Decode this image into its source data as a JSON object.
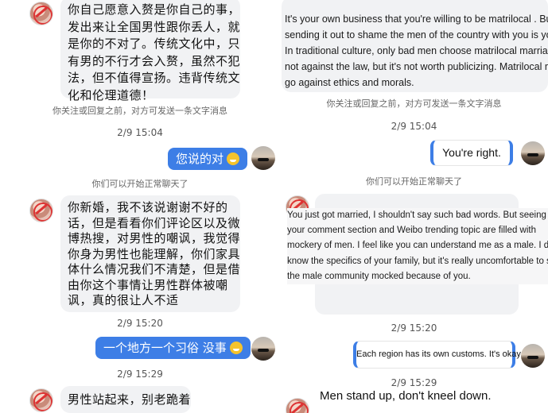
{
  "left": {
    "msg1": "你自己愿意入赘是你自己的事，\n发出来让全国男性跟你丢人，就\n是你的不对了。传统文化中，只\n有男的不行才会入赘，虽然不犯\n法，但不值得宣扬。违背传统文\n化和伦理道德！",
    "sys1": "你关注或回复之前，对方可发送一条文字消息",
    "ts1": "2/9 15:04",
    "sent1": "您说的对",
    "sys2": "你们可以开始正常聊天了",
    "msg2": "你新婚，我不该说谢谢不好的\n话，但是看看你们评论区以及微\n博热搜，对男性的嘲讽，我觉得\n你身为男性也能理解，你们家具\n体什么情况我们不清楚，但是借\n由你这个事情让男性群体被嘲\n讽，真的很让人不适",
    "ts2": "2/9 15:20",
    "sent2": "一个地方一个习俗 没事",
    "ts3": "2/9 15:29",
    "msg3": "男性站起来，别老跪着"
  },
  "right": {
    "msg1": "It's your own business that you're willing to be matrilocal . But\nsending it out to shame the men of the country with you is your fault.\nIn traditional culture, only bad men choose matrilocal marriage. It's\nnot against the law, but it's not worth publicizing. Matrilocal marriage\ngo against ethics and morals.",
    "sys1": "你关注或回复之前，对方可发送一条文字消息",
    "ts1": "2/9 15:04",
    "sent1": "You're right.",
    "sys2": "你们可以开始正常聊天了",
    "msg2": "You just got married, I shouldn't say such bad words. But seeing as\nyour comment section and Weibo trending topic are filled with\nmockery of men. I feel like you can understand me as a male. I don't\nknow the specifics of your family, but it's really uncomfortable to see\nthe male community mocked because of you.",
    "ts2": "2/9 15:20",
    "sent2": "Each region has its own customs. It's okay.",
    "ts3": "2/9 15:29",
    "msg3": "Men stand up, don't kneel down."
  },
  "icons": {
    "contact_avatar": "profile-avatar-icon",
    "self_avatar": "sunset-avatar-icon",
    "emoji": "grin-emoji-icon"
  },
  "colors": {
    "sent_bubble": "#3d7ee6",
    "received_bubble": "#f1f2f4",
    "system_text": "#666666"
  }
}
